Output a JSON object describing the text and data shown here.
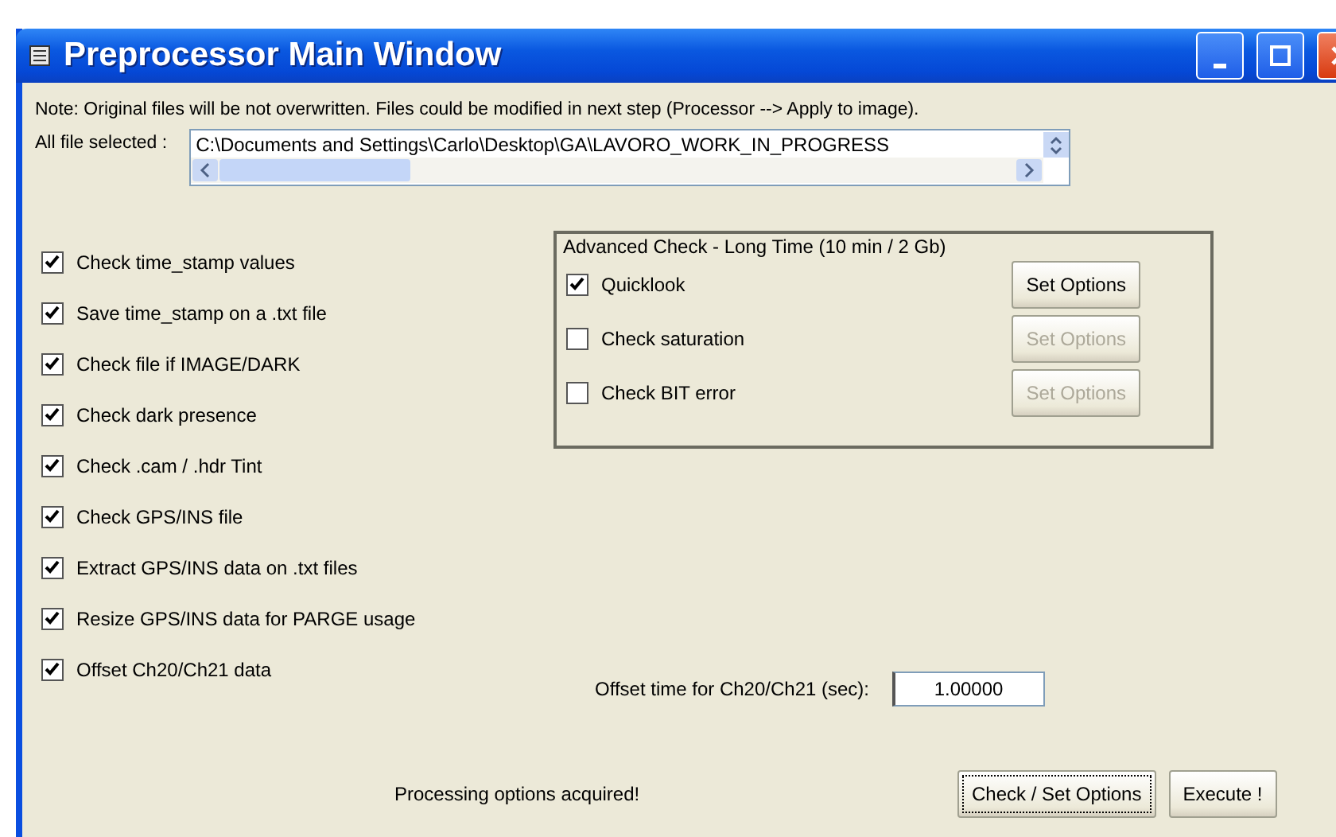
{
  "window": {
    "title": "Preprocessor Main Window"
  },
  "note": "Note: Original files will be not overwritten. Files could be modified in next step (Processor --> Apply to image).",
  "file_selection": {
    "label": "All file selected :",
    "value": "C:\\Documents and Settings\\Carlo\\Desktop\\GA\\LAVORO_WORK_IN_PROGRESS"
  },
  "options": [
    {
      "label": "Check time_stamp values",
      "checked": true
    },
    {
      "label": "Save time_stamp on a .txt file",
      "checked": true
    },
    {
      "label": "Check file if IMAGE/DARK",
      "checked": true
    },
    {
      "label": "Check dark presence",
      "checked": true
    },
    {
      "label": "Check .cam / .hdr Tint",
      "checked": true
    },
    {
      "label": "Check GPS/INS file",
      "checked": true
    },
    {
      "label": "Extract GPS/INS data on .txt files",
      "checked": true
    },
    {
      "label": "Resize GPS/INS data for PARGE usage",
      "checked": true
    },
    {
      "label": "Offset Ch20/Ch21 data",
      "checked": true
    }
  ],
  "advanced_check": {
    "title": "Advanced Check - Long Time (10 min / 2 Gb)",
    "options": [
      {
        "label": "Quicklook",
        "checked": true,
        "button": {
          "label": "Set Options",
          "disabled": false
        }
      },
      {
        "label": "Check saturation",
        "checked": false,
        "button": {
          "label": "Set Options",
          "disabled": true
        }
      },
      {
        "label": "Check BIT error",
        "checked": false,
        "button": {
          "label": "Set Options",
          "disabled": true
        }
      }
    ]
  },
  "offset": {
    "label": "Offset time for Ch20/Ch21 (sec):",
    "value": "1.00000"
  },
  "status": "Processing options acquired!",
  "buttons": [
    {
      "label": "Check / Set Options",
      "focused": true
    },
    {
      "label": "Execute !",
      "focused": false
    }
  ]
}
